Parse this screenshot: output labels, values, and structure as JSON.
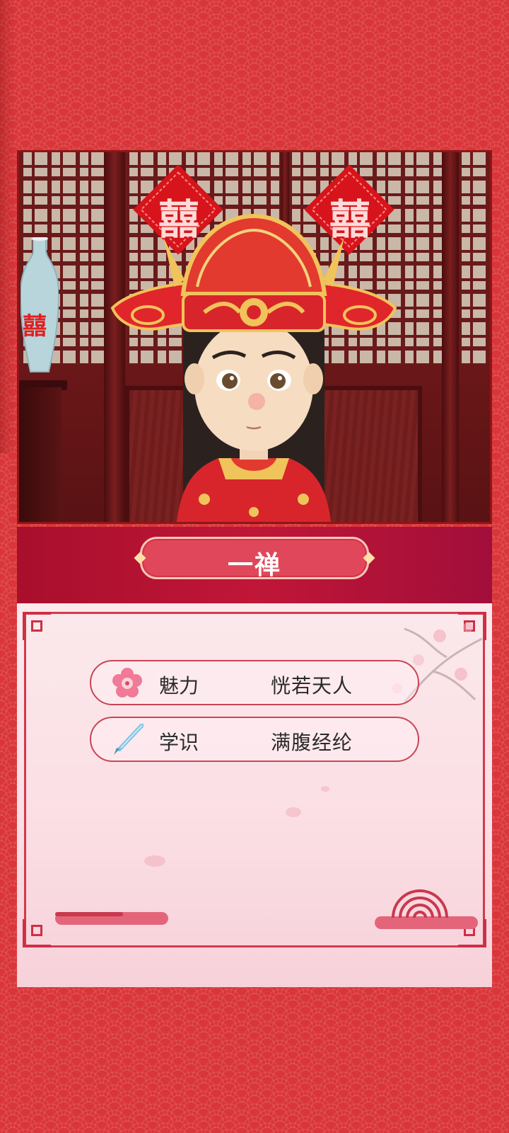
{
  "character": {
    "name": "一禅"
  },
  "scene": {
    "papercut_left": "囍",
    "papercut_right": "囍",
    "vase_char": "囍"
  },
  "stats": [
    {
      "icon": "plum-blossom-icon",
      "label": "魅力",
      "value": "恍若天人"
    },
    {
      "icon": "calligraphy-brush-icon",
      "label": "学识",
      "value": "满腹经纶"
    }
  ],
  "colors": {
    "background_red": "#d9363a",
    "name_band": "#c01637",
    "name_plate": "#e0475a",
    "card_pink": "#fbe9ec",
    "frame_red": "#d5384b"
  }
}
